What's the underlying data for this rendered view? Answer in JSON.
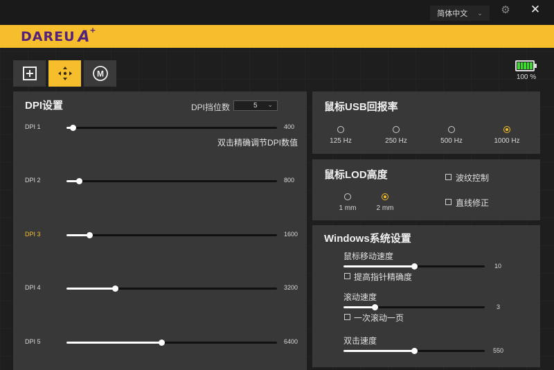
{
  "app": {
    "brand": "DAREU",
    "brand_mark": "A",
    "brand_plus": "+"
  },
  "titlebar": {
    "language": "简体中文",
    "language_chevron": "⌄",
    "gear_icon": "gear-icon",
    "close_symbol": "✕"
  },
  "modes": [
    {
      "name": "add",
      "icon": "plus-square-icon",
      "active": false
    },
    {
      "name": "move",
      "icon": "move-arrows-icon",
      "active": true
    },
    {
      "name": "macro",
      "icon": "circle-m-icon",
      "label": "M",
      "active": false
    }
  ],
  "battery": {
    "percent_label": "100 %",
    "level": 1.0,
    "color": "#3bdc2c"
  },
  "dpi": {
    "title": "DPI设置",
    "count_label": "DPI挡位数",
    "count_value": "5",
    "hint": "双击精确调节DPI数值",
    "max": 16000,
    "levels": [
      {
        "label": "DPI 1",
        "value": "400",
        "fraction": 0.03,
        "highlight": false
      },
      {
        "label": "DPI 2",
        "value": "800",
        "fraction": 0.06,
        "highlight": false
      },
      {
        "label": "DPI 3",
        "value": "1600",
        "fraction": 0.11,
        "highlight": true
      },
      {
        "label": "DPI 4",
        "value": "3200",
        "fraction": 0.23,
        "highlight": false
      },
      {
        "label": "DPI 5",
        "value": "6400",
        "fraction": 0.45,
        "highlight": false
      }
    ]
  },
  "usb": {
    "title": "鼠标USB回报率",
    "options": [
      {
        "label": "125 Hz",
        "selected": false
      },
      {
        "label": "250 Hz",
        "selected": false
      },
      {
        "label": "500 Hz",
        "selected": false
      },
      {
        "label": "1000 Hz",
        "selected": true
      }
    ]
  },
  "lod": {
    "title": "鼠标LOD高度",
    "options": [
      {
        "label": "1 mm",
        "selected": false
      },
      {
        "label": "2 mm",
        "selected": true
      }
    ],
    "checkboxes": [
      {
        "label": "波纹控制",
        "checked": false
      },
      {
        "label": "直线修正",
        "checked": false
      }
    ]
  },
  "windows": {
    "title": "Windows系统设置",
    "pointer_speed": {
      "label": "鼠标移动速度",
      "value": "10",
      "fraction": 0.5
    },
    "precision": {
      "label": "提高指针精确度",
      "checked": false
    },
    "scroll_speed": {
      "label": "滚动速度",
      "value": "3",
      "fraction": 0.22
    },
    "scroll_page": {
      "label": "一次滚动一页",
      "checked": false
    },
    "double_click": {
      "label": "双击速度",
      "value": "550",
      "fraction": 0.5
    }
  },
  "colors": {
    "accent": "#f6be2c",
    "brand_text": "#54227a",
    "panel": "#383838",
    "background": "#1e1e1e"
  }
}
